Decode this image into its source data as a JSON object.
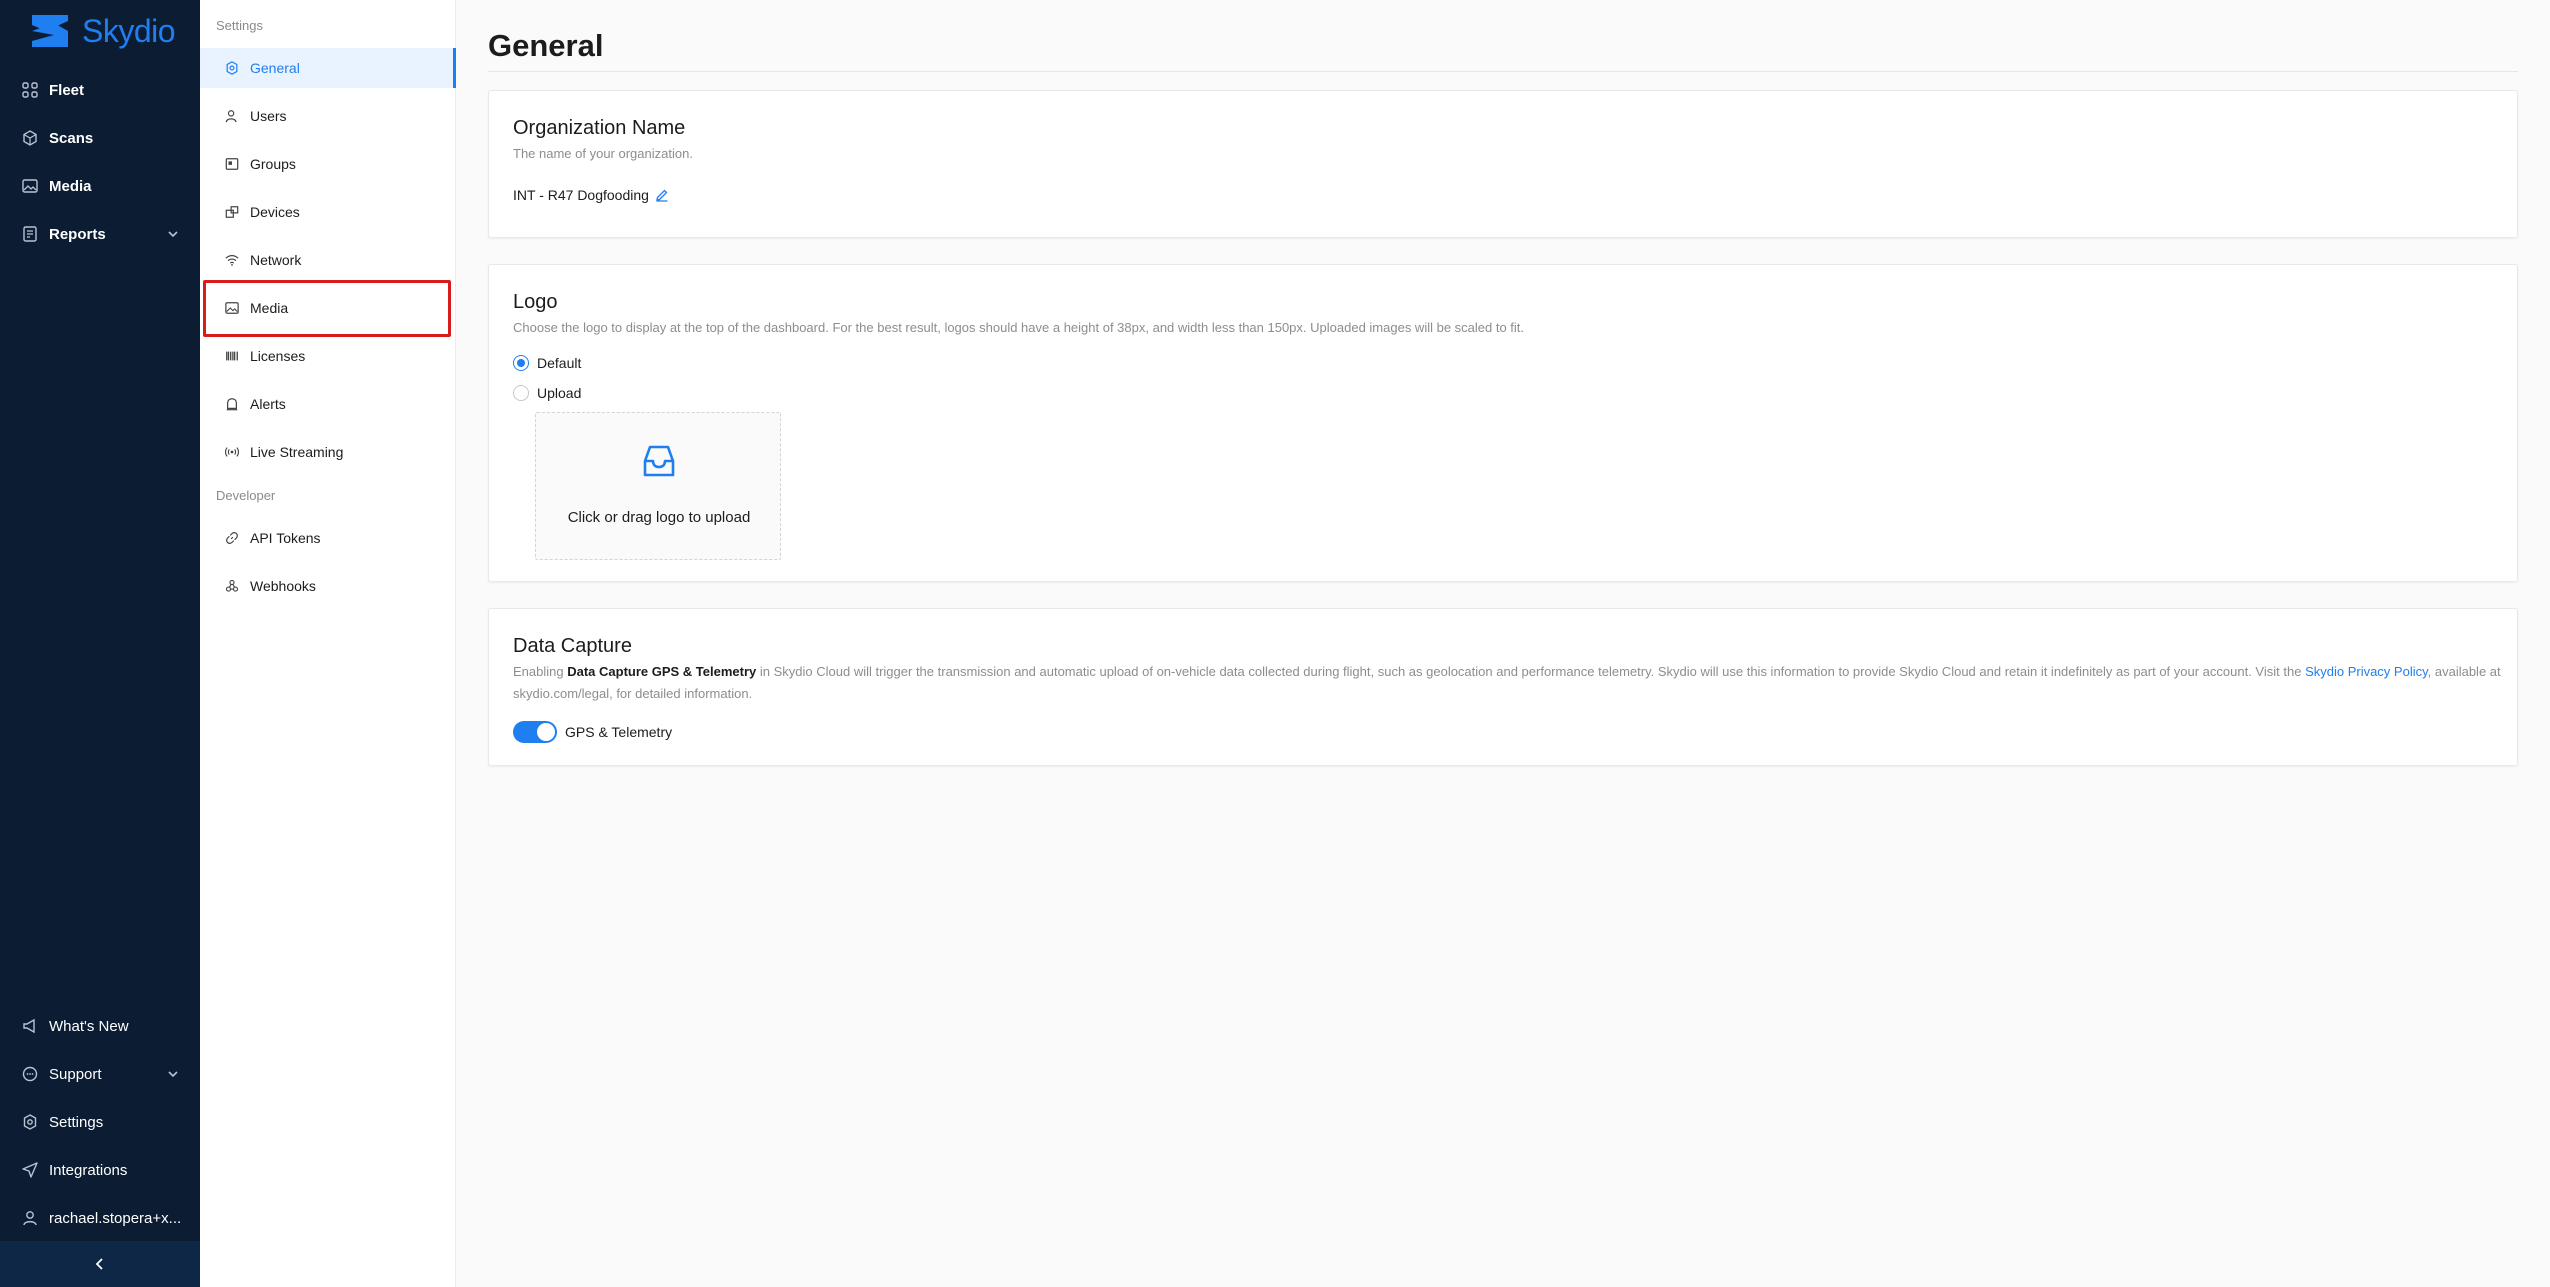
{
  "brand": {
    "name": "Skydio",
    "accent": "#1f7ff0"
  },
  "nav": {
    "items": [
      {
        "label": "Fleet",
        "icon": "fleet-icon"
      },
      {
        "label": "Scans",
        "icon": "scans-icon"
      },
      {
        "label": "Media",
        "icon": "media-icon"
      },
      {
        "label": "Reports",
        "icon": "reports-icon",
        "expandable": true
      }
    ],
    "bottom_items": [
      {
        "label": "What's New",
        "icon": "megaphone-icon"
      },
      {
        "label": "Support",
        "icon": "chat-icon",
        "expandable": true
      },
      {
        "label": "Settings",
        "icon": "gear-icon"
      },
      {
        "label": "Integrations",
        "icon": "send-icon"
      },
      {
        "label": "rachael.stopera+x...",
        "icon": "user-icon",
        "expandable": true
      }
    ]
  },
  "settings_menu": {
    "heading": "Settings",
    "items": [
      {
        "label": "General",
        "icon": "gear-icon",
        "active": true
      },
      {
        "label": "Users",
        "icon": "users-icon"
      },
      {
        "label": "Groups",
        "icon": "groups-icon"
      },
      {
        "label": "Devices",
        "icon": "devices-icon"
      },
      {
        "label": "Network",
        "icon": "wifi-icon"
      },
      {
        "label": "Media",
        "icon": "image-icon",
        "highlighted": true
      },
      {
        "label": "Licenses",
        "icon": "barcode-icon"
      },
      {
        "label": "Alerts",
        "icon": "alert-icon"
      },
      {
        "label": "Live Streaming",
        "icon": "broadcast-icon"
      }
    ],
    "developer_heading": "Developer",
    "developer_items": [
      {
        "label": "API Tokens",
        "icon": "link-icon"
      },
      {
        "label": "Webhooks",
        "icon": "webhook-icon"
      }
    ]
  },
  "main": {
    "title": "General",
    "org": {
      "title": "Organization Name",
      "description": "The name of your organization.",
      "value": "INT - R47 Dogfooding"
    },
    "logo": {
      "title": "Logo",
      "description": "Choose the logo to display at the top of the dashboard. For the best result, logos should have a height of 38px, and width less than 150px. Uploaded images will be scaled to fit.",
      "options": [
        {
          "label": "Default",
          "checked": true
        },
        {
          "label": "Upload",
          "checked": false
        }
      ],
      "upload_text": "Click or drag logo to upload"
    },
    "data_capture": {
      "title": "Data Capture",
      "desc_prefix": "Enabling ",
      "desc_bold": "Data Capture GPS & Telemetry",
      "desc_middle": " in Skydio Cloud will trigger the transmission and automatic upload of on-vehicle data collected during flight, such as geolocation and performance telemetry. Skydio will use this information to provide Skydio Cloud and retain it indefinitely as part of your account. Visit the ",
      "desc_link": "Skydio Privacy Policy",
      "desc_suffix": ", available at skydio.com/legal, for detailed information.",
      "toggle_label": "GPS & Telemetry",
      "toggle_on": true
    }
  }
}
